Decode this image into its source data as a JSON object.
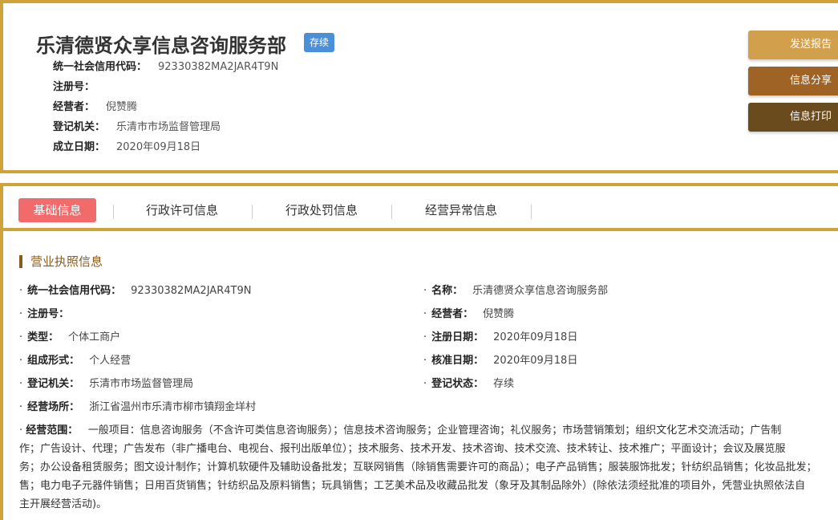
{
  "header": {
    "company_name": "乐清德贤众享信息咨询服务部",
    "status": "存续",
    "rows": [
      {
        "label": "统一社会信用代码：",
        "value": "92330382MA2JAR4T9N"
      },
      {
        "label": "注册号：",
        "value": ""
      },
      {
        "label": "经营者：",
        "value": "倪赞腾"
      },
      {
        "label": "登记机关：",
        "value": "乐清市市场监督管理局"
      },
      {
        "label": "成立日期：",
        "value": "2020年09月18日"
      }
    ]
  },
  "actions": {
    "send_report": "发送报告",
    "share_info": "信息分享",
    "print_info": "信息打印"
  },
  "tabs": [
    {
      "label": "基础信息"
    },
    {
      "label": "行政许可信息"
    },
    {
      "label": "行政处罚信息"
    },
    {
      "label": "经营异常信息"
    }
  ],
  "section": {
    "title": "营业执照信息"
  },
  "details": {
    "credit_code": {
      "label": "统一社会信用代码：",
      "value": "92330382MA2JAR4T9N"
    },
    "name": {
      "label": "名称：",
      "value": "乐清德贤众享信息咨询服务部"
    },
    "reg_no": {
      "label": "注册号：",
      "value": ""
    },
    "operator": {
      "label": "经营者：",
      "value": "倪赞腾"
    },
    "type": {
      "label": "类型：",
      "value": "个体工商户"
    },
    "reg_date": {
      "label": "注册日期：",
      "value": "2020年09月18日"
    },
    "form": {
      "label": "组成形式：",
      "value": "个人经营"
    },
    "approve_date": {
      "label": "核准日期：",
      "value": "2020年09月18日"
    },
    "authority": {
      "label": "登记机关：",
      "value": "乐清市市场监督管理局"
    },
    "reg_status": {
      "label": "登记状态：",
      "value": "存续"
    },
    "address": {
      "label": "经营场所：",
      "value": "浙江省温州市乐清市柳市镇翔金垟村"
    },
    "scope_label": "经营范围：",
    "scope_lines": [
      "一般项目：信息咨询服务（不含许可类信息咨询服务）；信息技术咨询服务；企业管理咨询；礼仪服务；市场营销策划；组织文化艺术交流活动；广告制",
      "作；广告设计、代理；广告发布（非广播电台、电视台、报刊出版单位）；技术服务、技术开发、技术咨询、技术交流、技术转让、技术推广；平面设计；会议及展览服",
      "务；办公设备租赁服务；图文设计制作；计算机软硬件及辅助设备批发；互联网销售（除销售需要许可的商品）；电子产品销售；服装服饰批发；针纺织品销售；化妆品批发；",
      "售；电力电子元器件销售；日用百货销售；针纺织品及原料销售；玩具销售；工艺美术品及收藏品批发（象牙及其制品除外）(除依法须经批准的项目外，凭营业执照依法自",
      "主开展经营活动)。"
    ]
  }
}
